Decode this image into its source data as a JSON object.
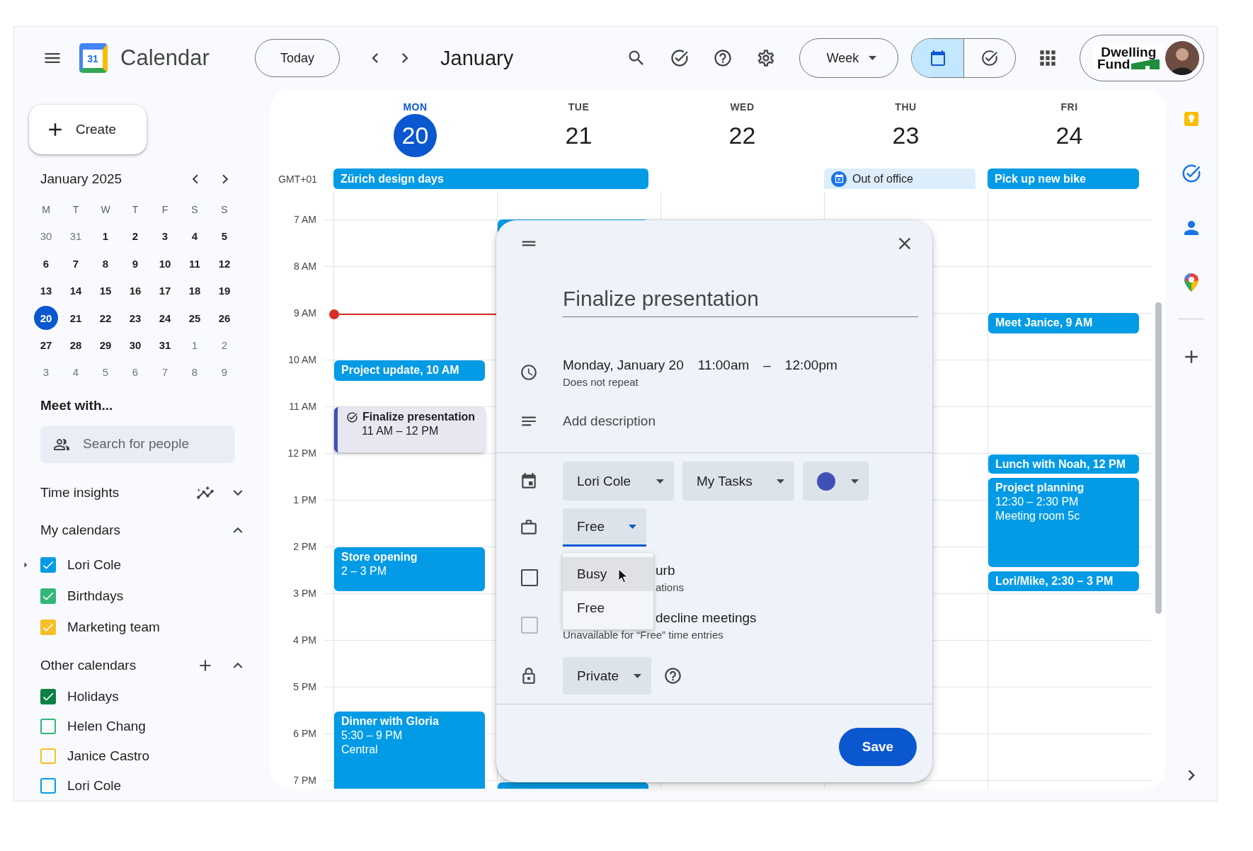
{
  "topbar": {
    "app_name": "Calendar",
    "logo_day": "31",
    "today_button": "Today",
    "period_title": "January",
    "view_select": "Week",
    "view_toggle": [
      {
        "kind": "calendar",
        "selected": true
      },
      {
        "kind": "tasks",
        "selected": false
      }
    ],
    "org_logo": [
      "Dwelling",
      "Fund"
    ]
  },
  "sidebar": {
    "create_button": "Create",
    "mini_calendar": {
      "title": "January 2025",
      "weekdays": [
        "M",
        "T",
        "W",
        "T",
        "F",
        "S",
        "S"
      ],
      "weeks": [
        [
          {
            "day": "30",
            "muted": true,
            "selected": false
          },
          {
            "day": "31",
            "muted": true,
            "selected": false
          },
          {
            "day": "1",
            "muted": false,
            "selected": false
          },
          {
            "day": "2",
            "muted": false,
            "selected": false
          },
          {
            "day": "3",
            "muted": false,
            "selected": false
          },
          {
            "day": "4",
            "muted": false,
            "selected": false
          },
          {
            "day": "5",
            "muted": false,
            "selected": false
          }
        ],
        [
          {
            "day": "6",
            "muted": false,
            "selected": false
          },
          {
            "day": "7",
            "muted": false,
            "selected": false
          },
          {
            "day": "8",
            "muted": false,
            "selected": false
          },
          {
            "day": "9",
            "muted": false,
            "selected": false
          },
          {
            "day": "10",
            "muted": false,
            "selected": false
          },
          {
            "day": "11",
            "muted": false,
            "selected": false
          },
          {
            "day": "12",
            "muted": false,
            "selected": false
          }
        ],
        [
          {
            "day": "13",
            "muted": false,
            "selected": false
          },
          {
            "day": "14",
            "muted": false,
            "selected": false
          },
          {
            "day": "15",
            "muted": false,
            "selected": false
          },
          {
            "day": "16",
            "muted": false,
            "selected": false
          },
          {
            "day": "17",
            "muted": false,
            "selected": false
          },
          {
            "day": "18",
            "muted": false,
            "selected": false
          },
          {
            "day": "19",
            "muted": false,
            "selected": false
          }
        ],
        [
          {
            "day": "20",
            "muted": false,
            "selected": true
          },
          {
            "day": "21",
            "muted": false,
            "selected": false
          },
          {
            "day": "22",
            "muted": false,
            "selected": false
          },
          {
            "day": "23",
            "muted": false,
            "selected": false
          },
          {
            "day": "24",
            "muted": false,
            "selected": false
          },
          {
            "day": "25",
            "muted": false,
            "selected": false
          },
          {
            "day": "26",
            "muted": false,
            "selected": false
          }
        ],
        [
          {
            "day": "27",
            "muted": false,
            "selected": false
          },
          {
            "day": "28",
            "muted": false,
            "selected": false
          },
          {
            "day": "29",
            "muted": false,
            "selected": false
          },
          {
            "day": "30",
            "muted": false,
            "selected": false
          },
          {
            "day": "31",
            "muted": false,
            "selected": false
          },
          {
            "day": "1",
            "muted": true,
            "selected": false
          },
          {
            "day": "2",
            "muted": true,
            "selected": false
          }
        ],
        [
          {
            "day": "3",
            "muted": true,
            "selected": false
          },
          {
            "day": "4",
            "muted": true,
            "selected": false
          },
          {
            "day": "5",
            "muted": true,
            "selected": false
          },
          {
            "day": "6",
            "muted": true,
            "selected": false
          },
          {
            "day": "7",
            "muted": true,
            "selected": false
          },
          {
            "day": "8",
            "muted": true,
            "selected": false
          },
          {
            "day": "9",
            "muted": true,
            "selected": false
          }
        ]
      ]
    },
    "meet_with": {
      "title": "Meet with...",
      "search_placeholder": "Search for people"
    },
    "time_insights": {
      "title": "Time insights",
      "expanded": false
    },
    "my_calendars": {
      "title": "My calendars",
      "expanded": true,
      "items": [
        {
          "name": "Lori Cole",
          "checked": true,
          "expandable": true,
          "color": "#039be5"
        },
        {
          "name": "Birthdays",
          "checked": true,
          "expandable": false,
          "color": "#33b679"
        },
        {
          "name": "Marketing team",
          "checked": true,
          "expandable": false,
          "color": "#f6bf26"
        }
      ]
    },
    "other_calendars": {
      "title": "Other calendars",
      "expanded": true,
      "items": [
        {
          "name": "Holidays",
          "checked": true,
          "expandable": false,
          "color": "#0b8043"
        },
        {
          "name": "Helen Chang",
          "checked": false,
          "expandable": false,
          "color": "#33b679"
        },
        {
          "name": "Janice Castro",
          "checked": false,
          "expandable": false,
          "color": "#f6bf26"
        },
        {
          "name": "Lori Cole",
          "checked": false,
          "expandable": false,
          "color": "#039be5"
        }
      ]
    }
  },
  "week": {
    "timezone": "GMT+01",
    "days": [
      {
        "weekday": "MON",
        "date": "20",
        "selected": true,
        "events": [
          {
            "kind": "event",
            "lines": [
              "Project update, 10 AM"
            ]
          },
          {
            "kind": "task",
            "lines": [
              "Finalize presentation",
              "11 AM – 12 PM"
            ]
          },
          {
            "kind": "event",
            "lines": [
              "Store opening",
              "2 – 3 PM"
            ]
          },
          {
            "kind": "event",
            "lines": [
              "Dinner with Gloria",
              "5:30 – 9 PM",
              "Central"
            ]
          }
        ]
      },
      {
        "weekday": "TUE",
        "date": "21",
        "selected": false,
        "events": [
          {
            "kind": "covered"
          },
          {
            "kind": "covered"
          }
        ]
      },
      {
        "weekday": "WED",
        "date": "22",
        "selected": false
      },
      {
        "weekday": "THU",
        "date": "23",
        "selected": false
      },
      {
        "weekday": "FRI",
        "date": "24",
        "selected": false,
        "events": [
          {
            "kind": "event",
            "lines": [
              "Meet Janice, 9 AM"
            ]
          },
          {
            "kind": "event",
            "lines": [
              "Lunch with Noah, 12 PM"
            ]
          },
          {
            "kind": "event",
            "lines": [
              "Project planning",
              "12:30 – 2:30 PM",
              "Meeting room 5c"
            ]
          },
          {
            "kind": "event",
            "lines": [
              "Lori/Mike, 2:30 – 3 PM"
            ]
          }
        ]
      }
    ],
    "all_day_events": [
      {
        "title": "Zürich design days",
        "kind": "event"
      },
      {
        "title": "Out of office",
        "kind": "out_of_office"
      },
      {
        "title": "Pick up new bike",
        "kind": "event"
      }
    ],
    "hours": [
      "7 AM",
      "8 AM",
      "9 AM",
      "10 AM",
      "11 AM",
      "12 PM",
      "1 PM",
      "2 PM",
      "3 PM",
      "4 PM",
      "5 PM",
      "6 PM",
      "7 PM"
    ]
  },
  "event_editor": {
    "title": "Finalize presentation",
    "date": "Monday, January 20",
    "start_time": "11:00am",
    "time_separator": "–",
    "end_time": "12:00pm",
    "repeat": "Does not repeat",
    "description_placeholder": "Add description",
    "calendar_select": "Lori Cole",
    "list_select": "My Tasks",
    "availability": {
      "value": "Free",
      "open": true,
      "options": [
        {
          "label": "Busy",
          "highlighted": true
        },
        {
          "label": "Free",
          "highlighted": false
        }
      ]
    },
    "options": [
      {
        "title": "urb",
        "subtitle": "ations",
        "checked": false,
        "disabled": false
      },
      {
        "title": "decline meetings",
        "subtitle": "Unavailable for “Free” time entries",
        "checked": false,
        "disabled": true
      }
    ],
    "visibility_select": "Private",
    "save_button": "Save"
  }
}
